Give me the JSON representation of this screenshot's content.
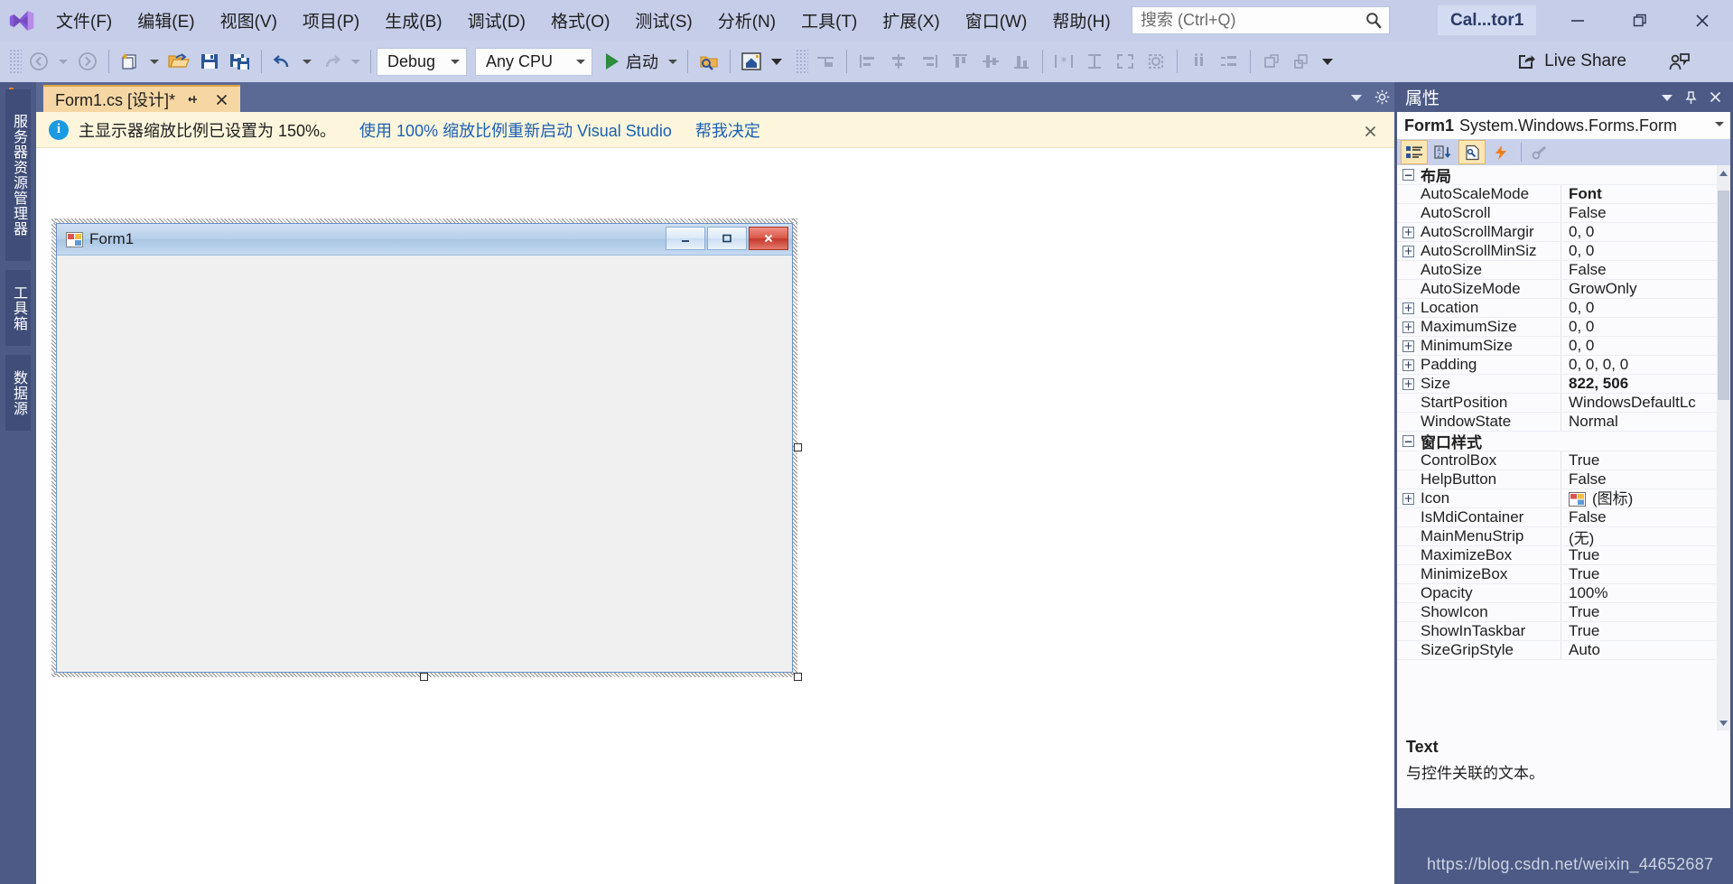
{
  "titlebar": {
    "logo_icon": "visual-studio-logo",
    "menus": [
      "文件(F)",
      "编辑(E)",
      "视图(V)",
      "项目(P)",
      "生成(B)",
      "调试(D)",
      "格式(O)",
      "测试(S)",
      "分析(N)",
      "工具(T)",
      "扩展(X)",
      "窗口(W)",
      "帮助(H)"
    ],
    "search_placeholder": "搜索 (Ctrl+Q)",
    "search_value": "",
    "search_icon": "search-icon",
    "project_chip": "Cal...tor1",
    "minimize_icon": "minimize-icon",
    "restore_icon": "restore-icon",
    "close_icon": "close-icon",
    "bg_color": "#c5cde8"
  },
  "toolbar": {
    "back_icon": "navigate-back-icon",
    "forward_icon": "navigate-forward-icon",
    "new_item_icon": "new-item-icon",
    "open_icon": "open-file-icon",
    "save_icon": "save-icon",
    "save_all_icon": "save-all-icon",
    "undo_icon": "undo-icon",
    "redo_icon": "redo-icon",
    "configuration": "Debug",
    "platform": "Any CPU",
    "start_label": "启动",
    "start_icon": "play-icon",
    "find_icon": "find-in-files-icon",
    "home_icon": "solution-explorer-home-icon",
    "align_left_icon": "align-left-icon",
    "align_center_icon": "align-center-icon",
    "align_right_icon": "align-right-icon",
    "align_top_icon": "align-top-icon",
    "align_middle_icon": "align-middle-icon",
    "align_bottom_icon": "align-bottom-icon",
    "make_same_width_icon": "make-same-width-icon",
    "make_same_height_icon": "make-same-height-icon",
    "make_same_size_icon": "make-same-size-icon",
    "size_to_grid_icon": "size-to-grid-icon",
    "horiz_spacing_icon": "horizontal-spacing-icon",
    "vert_spacing_icon": "vertical-spacing-icon",
    "bring_to_front_icon": "bring-to-front-icon",
    "send_to_back_icon": "send-to-back-icon",
    "overflow_icon": "toolbar-overflow-icon",
    "live_share_label": "Live Share",
    "live_share_icon": "live-share-icon",
    "feedback_icon": "send-feedback-icon",
    "bg_color": "#c8d0ea"
  },
  "left_rail": {
    "tabs": [
      "服务器资源管理器",
      "工具箱",
      "数据源"
    ],
    "bg_color": "#4c5a85"
  },
  "document": {
    "tab_label": "Form1.cs [设计]*",
    "tab_pin_icon": "pin-icon",
    "tab_close_icon": "close-icon",
    "tabstrip_menu_icon": "chevron-down-icon",
    "tabstrip_settings_icon": "gear-icon",
    "tab_bg_color": "#f6d7a4"
  },
  "infobar": {
    "icon": "info-icon",
    "icon_glyph": "i",
    "message": "主显示器缩放比例已设置为 150%。",
    "link_primary": "使用 100% 缩放比例重新启动 Visual Studio",
    "link_secondary": "帮我决定",
    "close_icon": "close-icon",
    "bg_color": "#fdf6dc",
    "link_color": "#1a5fb4"
  },
  "designer": {
    "form_title": "Form1",
    "form_icon": "windows-form-icon",
    "minimize_icon": "minimize-icon",
    "maximize_icon": "maximize-icon",
    "close_icon": "close-icon"
  },
  "properties": {
    "panel_title": "属性",
    "dropdown_icon": "chevron-down-icon",
    "pin_icon": "pin-icon",
    "close_icon": "close-icon",
    "object_name": "Form1",
    "object_type": "System.Windows.Forms.Form",
    "object_caret_icon": "chevron-down-icon",
    "toolbar_icons": [
      "categorized-view-icon",
      "alphabetical-sort-icon",
      "properties-page-icon",
      "events-icon",
      "property-pages-icon"
    ],
    "scroll_up_icon": "scroll-up-arrow-icon",
    "scroll_down_icon": "scroll-down-arrow-icon",
    "groups": [
      {
        "name": "布局",
        "expander": "−",
        "rows": [
          {
            "expander": "",
            "name": "AutoScaleMode",
            "value": "Font",
            "bold": true
          },
          {
            "expander": "",
            "name": "AutoScroll",
            "value": "False",
            "bold": false
          },
          {
            "expander": "+",
            "name": "AutoScrollMargir",
            "value": "0, 0",
            "bold": false
          },
          {
            "expander": "+",
            "name": "AutoScrollMinSiz",
            "value": "0, 0",
            "bold": false
          },
          {
            "expander": "",
            "name": "AutoSize",
            "value": "False",
            "bold": false
          },
          {
            "expander": "",
            "name": "AutoSizeMode",
            "value": "GrowOnly",
            "bold": false
          },
          {
            "expander": "+",
            "name": "Location",
            "value": "0, 0",
            "bold": false
          },
          {
            "expander": "+",
            "name": "MaximumSize",
            "value": "0, 0",
            "bold": false
          },
          {
            "expander": "+",
            "name": "MinimumSize",
            "value": "0, 0",
            "bold": false
          },
          {
            "expander": "+",
            "name": "Padding",
            "value": "0, 0, 0, 0",
            "bold": false
          },
          {
            "expander": "+",
            "name": "Size",
            "value": "822, 506",
            "bold": true
          },
          {
            "expander": "",
            "name": "StartPosition",
            "value": "WindowsDefaultLc",
            "bold": false
          },
          {
            "expander": "",
            "name": "WindowState",
            "value": "Normal",
            "bold": false
          }
        ]
      },
      {
        "name": "窗口样式",
        "expander": "−",
        "rows": [
          {
            "expander": "",
            "name": "ControlBox",
            "value": "True",
            "bold": false
          },
          {
            "expander": "",
            "name": "HelpButton",
            "value": "False",
            "bold": false
          },
          {
            "expander": "+",
            "name": "Icon",
            "value": "(图标)",
            "bold": false,
            "swatch": "windows-form-icon"
          },
          {
            "expander": "",
            "name": "IsMdiContainer",
            "value": "False",
            "bold": false
          },
          {
            "expander": "",
            "name": "MainMenuStrip",
            "value": "(无)",
            "bold": false
          },
          {
            "expander": "",
            "name": "MaximizeBox",
            "value": "True",
            "bold": false
          },
          {
            "expander": "",
            "name": "MinimizeBox",
            "value": "True",
            "bold": false
          },
          {
            "expander": "",
            "name": "Opacity",
            "value": "100%",
            "bold": false
          },
          {
            "expander": "",
            "name": "ShowIcon",
            "value": "True",
            "bold": false
          },
          {
            "expander": "",
            "name": "ShowInTaskbar",
            "value": "True",
            "bold": false
          },
          {
            "expander": "",
            "name": "SizeGripStyle",
            "value": "Auto",
            "bold": false
          }
        ]
      }
    ],
    "description_title": "Text",
    "description_text": "与控件关联的文本。"
  },
  "watermark": "https://blog.csdn.net/weixin_44652687"
}
